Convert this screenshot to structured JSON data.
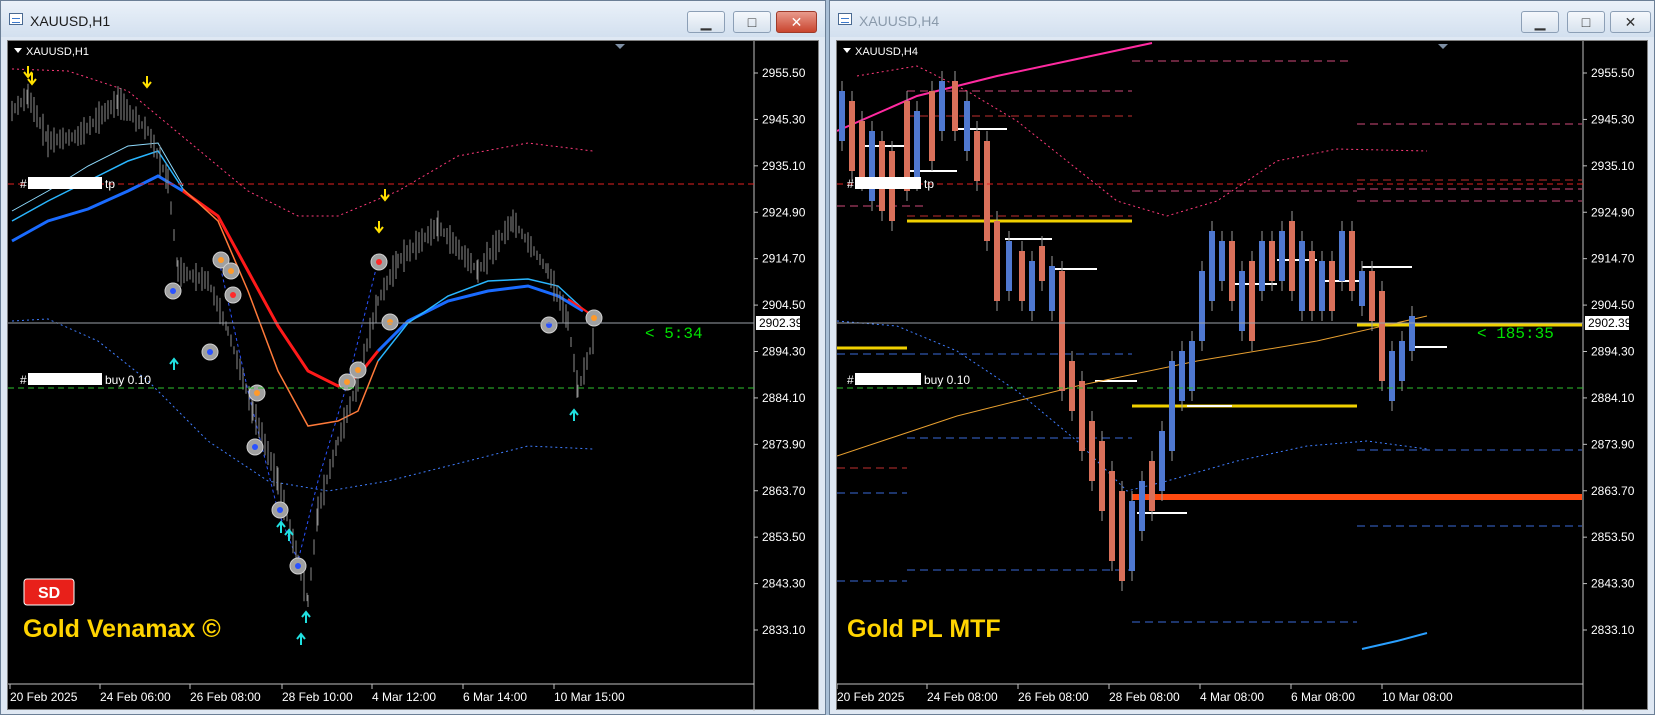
{
  "windows": [
    {
      "title": "XAUUSD,H1",
      "symbol_label": "XAUUSD,H1",
      "y_ticks": [
        "2955.50",
        "2945.30",
        "2935.10",
        "2924.90",
        "2914.70",
        "2904.50",
        "2894.30",
        "2884.10",
        "2873.90",
        "2863.70",
        "2853.50",
        "2843.30",
        "2833.10"
      ],
      "current_price": "2902.39",
      "x_ticks": [
        "20 Feb 2025",
        "24 Feb 06:00",
        "26 Feb 08:00",
        "28 Feb 10:00",
        "4 Mar 12:00",
        "6 Mar 14:00",
        "10 Mar 15:00"
      ],
      "order_tp": {
        "prefix": "#",
        "suffix": "tp"
      },
      "order_buy": {
        "prefix": "#",
        "suffix": "buy 0.10"
      },
      "countdown": "< 5:34",
      "badge": "SD",
      "brand": "Gold Venamax ©",
      "colors": {
        "ma_rising": "#1a6bff",
        "ma_falling": "#ff2020",
        "envelope_upper": "#ff3a7a",
        "envelope_lower": "#3f7dff",
        "brand": "#ffd400"
      }
    },
    {
      "title": "XAUUSD,H4",
      "symbol_label": "XAUUSD,H4",
      "y_ticks": [
        "2955.50",
        "2945.30",
        "2935.10",
        "2924.90",
        "2914.70",
        "2904.50",
        "2894.30",
        "2884.10",
        "2873.90",
        "2863.70",
        "2853.50",
        "2843.30",
        "2833.10"
      ],
      "current_price": "2902.39",
      "x_ticks": [
        "20 Feb 2025",
        "24 Feb 08:00",
        "26 Feb 08:00",
        "28 Feb 08:00",
        "4 Mar 08:00",
        "6 Mar 08:00",
        "10 Mar 08:00"
      ],
      "order_tp": {
        "prefix": "#",
        "suffix": "tp"
      },
      "order_buy": {
        "prefix": "#",
        "suffix": "buy 0.10"
      },
      "countdown": "< 185:35",
      "brand": "Gold PL MTF",
      "colors": {
        "bull_candle": "#4f78d0",
        "bear_candle": "#d9705a",
        "pivot_gold": "#f0d000",
        "pivot_orange": "#ff4a10",
        "ma_pink": "#ff2aa0",
        "ma_orange": "#e8a030"
      }
    }
  ],
  "buttons": {
    "minimize": "▁",
    "maximize": "□",
    "close": "✕"
  }
}
